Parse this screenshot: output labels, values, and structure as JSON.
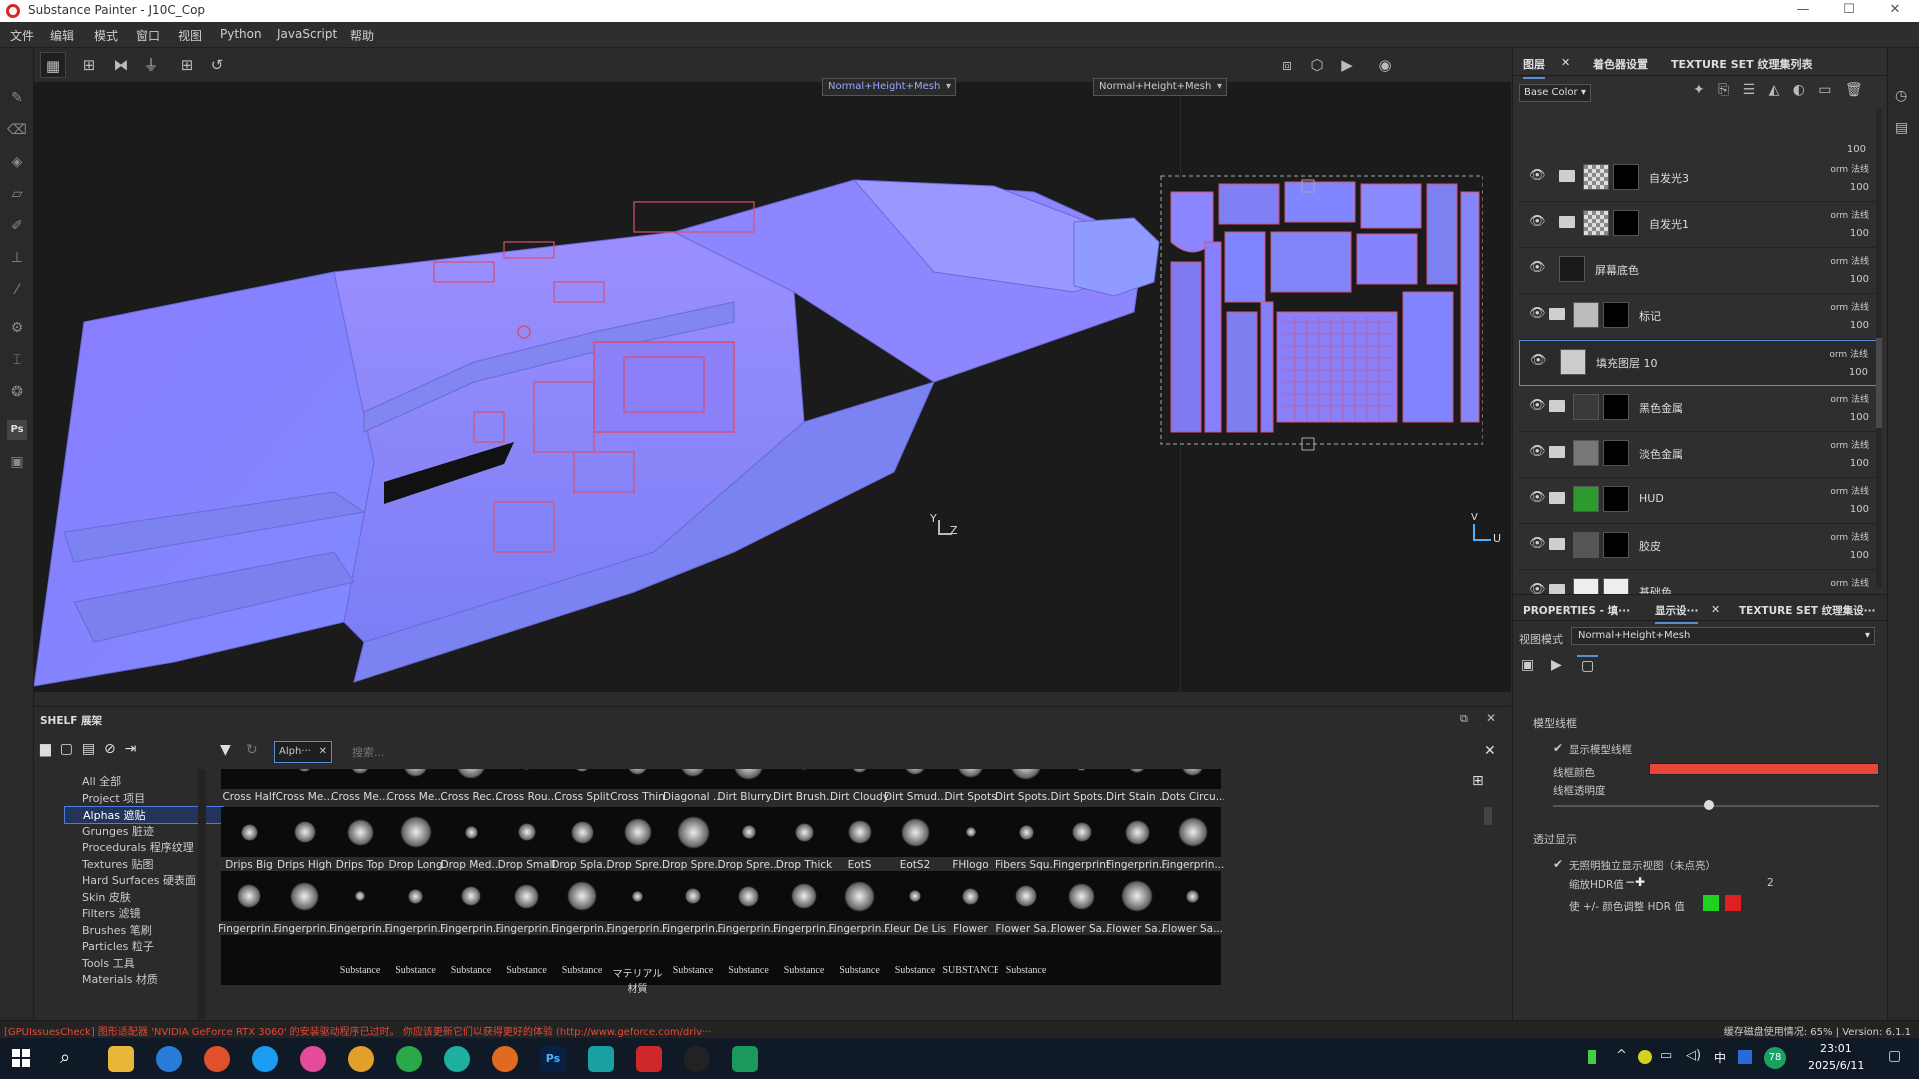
{
  "window": {
    "title": "Substance Painter - J10C_Cop"
  },
  "menu": [
    "文件",
    "编辑",
    "模式",
    "窗口",
    "视图",
    "Python",
    "JavaScript",
    "帮助"
  ],
  "viewport": {
    "mode_3d": "Normal+Height+Mesh",
    "mode_uv": "Normal+Height+Mesh",
    "axis_3d_label": "Z",
    "axis_3d_label_y": "Y",
    "axis_uv_label": "U",
    "axis_uv_label_y": "V"
  },
  "layers_panel": {
    "tabs": [
      "图层",
      "着色器设置",
      "TEXTURE SET 纹理集列表"
    ],
    "channel": "Base Color",
    "top_opacity": "100",
    "layers": [
      {
        "name": "自发光3",
        "blend": "orm 法线",
        "opacity": "100",
        "folder": true,
        "thumb": "checker"
      },
      {
        "name": "自发光1",
        "blend": "orm 法线",
        "opacity": "100",
        "folder": true,
        "thumb": "checker"
      },
      {
        "name": "屏幕底色",
        "blend": "orm 法线",
        "opacity": "100",
        "folder": false,
        "thumb": "dark"
      },
      {
        "name": "标记",
        "blend": "orm 法线",
        "opacity": "100",
        "folder": true,
        "thumb": "grey"
      },
      {
        "name": "填充图层 10",
        "blend": "orm 法线",
        "opacity": "100",
        "folder": false,
        "thumb": "lightgrey",
        "selected": true
      },
      {
        "name": "黑色金属",
        "blend": "orm 法线",
        "opacity": "100",
        "folder": true,
        "thumb": "noise"
      },
      {
        "name": "淡色金属",
        "blend": "orm 法线",
        "opacity": "100",
        "folder": true,
        "thumb": "lightnoise"
      },
      {
        "name": "HUD",
        "blend": "orm 法线",
        "opacity": "100",
        "folder": true,
        "thumb": "green"
      },
      {
        "name": "胶皮",
        "blend": "orm 法线",
        "opacity": "100",
        "folder": true,
        "thumb": "darknoise"
      },
      {
        "name": "基础色",
        "blend": "orm 法线",
        "opacity": "100",
        "folder": true,
        "thumb": "white"
      }
    ]
  },
  "properties_panel": {
    "tabs": [
      "PROPERTIES - 填···",
      "显示设···",
      "TEXTURE SET 纹理集设···"
    ],
    "view_mode_label": "视图模式",
    "view_mode_value": "Normal+Height+Mesh",
    "section_wireframe": "模型线框",
    "show_wireframe": "显示模型线框",
    "wire_color_label": "线框颜色",
    "wire_color": "#e8463a",
    "wire_opacity_label": "线框透明度",
    "wire_opacity_value": 0.48,
    "section_transparency": "透过显示",
    "unlit_label": "无照明独立显示视图（未点亮）",
    "hdr_label": "缩放HDR值",
    "hdr_value": "2",
    "hdr_color_label": "使 +/- 颜色调整 HDR 值",
    "hdr_plus_color": "#1ed21e",
    "hdr_minus_color": "#e02020"
  },
  "shelf": {
    "title": "SHELF 展架",
    "filter_tag": "Alph···",
    "search_placeholder": "搜索...",
    "categories": [
      {
        "label": "All 全部"
      },
      {
        "label": "Project 项目"
      },
      {
        "label": "Alphas 遮贴",
        "selected": true
      },
      {
        "label": "Grunges 脏迹"
      },
      {
        "label": "Procedurals 程序纹理"
      },
      {
        "label": "Textures 贴图"
      },
      {
        "label": "Hard Surfaces 硬表面"
      },
      {
        "label": "Skin 皮肤"
      },
      {
        "label": "Filters 滤镜"
      },
      {
        "label": "Brushes 笔刷"
      },
      {
        "label": "Particles 粒子"
      },
      {
        "label": "Tools 工具"
      },
      {
        "label": "Materials 材质"
      }
    ],
    "rows": [
      [
        "Cross Half",
        "Cross Me...",
        "Cross Me...",
        "Cross Me...",
        "Cross Rec...",
        "Cross Rou...",
        "Cross Split",
        "Cross Thin",
        "Diagonal ...",
        "Dirt Blurry...",
        "Dirt Brush...",
        "Dirt Cloudy",
        "Dirt Smud...",
        "Dirt Spots",
        "Dirt Spots...",
        "Dirt Spots...",
        "Dirt Stain ...",
        "Dots Circu..."
      ],
      [
        "Drips Big",
        "Drips High",
        "Drips Top",
        "Drop Long",
        "Drop Med...",
        "Drop Small",
        "Drop Spla...",
        "Drop Spre...",
        "Drop Spre...",
        "Drop Spre...",
        "Drop Thick",
        "EotS",
        "EotS2",
        "FHlogo",
        "Fibers Squ...",
        "Fingerprint",
        "Fingerprin...",
        "Fingerprin..."
      ],
      [
        "Fingerprin...",
        "Fingerprin...",
        "Fingerprin...",
        "Fingerprin...",
        "Fingerprin...",
        "Fingerprin...",
        "Fingerprin...",
        "Fingerprin...",
        "Fingerprin...",
        "Fingerprin...",
        "Fingerprin...",
        "Fingerprin...",
        "Fleur De Lis",
        "Flower",
        "Flower Sa...",
        "Flower Sa...",
        "Flower Sa...",
        "Flower Sa..."
      ],
      [
        "",
        "",
        "Substance",
        "Substance",
        "Substance",
        "Substance",
        "Substance",
        "マテリアル材質",
        "Substance",
        "Substance",
        "Substance",
        "Substance",
        "Substance",
        "SUBSTANCE",
        "Substance",
        "",
        "",
        ""
      ]
    ]
  },
  "status": {
    "message": "[GPUIssuesCheck] 图形适配器 'NVIDIA GeForce RTX 3060' 的安装驱动程序已过时。 你应该更新它们以获得更好的体验 (http://www.geforce.com/driv···",
    "disk": "缓存磁盘使用情况: 65% | Version: 6.1.1"
  },
  "taskbar": {
    "time": "23:01",
    "date": "2025/6/11",
    "ime": "中",
    "badge": "78"
  }
}
